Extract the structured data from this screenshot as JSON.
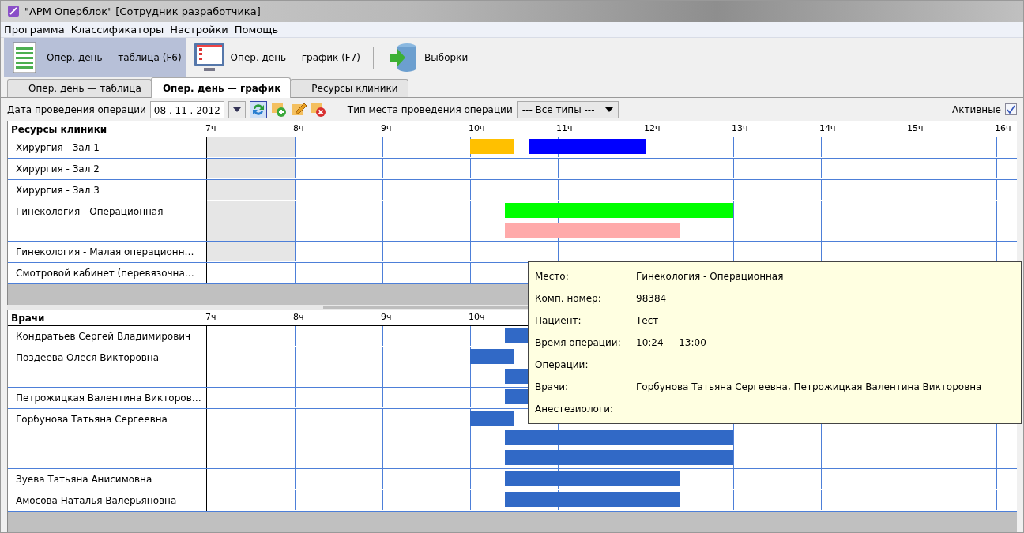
{
  "window": {
    "title": "\"АРМ Оперблок\" [Сотрудник разработчика]"
  },
  "menu": [
    "Программа",
    "Классификаторы",
    "Настройки",
    "Помощь"
  ],
  "toolbar": [
    {
      "label": "Опер. день — таблица (F6)",
      "kind": "table",
      "selected": true
    },
    {
      "label": "Опер. день — график (F7)",
      "kind": "monitor",
      "selected": false
    },
    {
      "label": "Выборки",
      "kind": "database",
      "selected": false
    }
  ],
  "tabs": [
    {
      "label": "Опер. день — таблица",
      "selected": false
    },
    {
      "label": "Опер. день — график",
      "selected": true
    },
    {
      "label": "Ресурсы клиники",
      "selected": false
    }
  ],
  "filters": {
    "date_label": "Дата проведения операции",
    "date_value": "08 . 11 . 2012",
    "type_label": "Тип места проведения операции",
    "type_value": "--- Все типы ---",
    "active_label": "Активные",
    "active_checked": true
  },
  "resources_chart": {
    "title": "Ресурсы клиники",
    "hours": [
      "7ч",
      "8ч",
      "9ч",
      "10ч",
      "11ч",
      "12ч",
      "13ч",
      "14ч",
      "15ч",
      "16ч"
    ],
    "rows": [
      {
        "name": "Хирургия - Зал 1",
        "blocked": true,
        "lanes": [
          [
            {
              "kind": "operation",
              "color": "#ffc000"
            },
            {
              "kind": "operation",
              "color": "#0000ff"
            }
          ]
        ]
      },
      {
        "name": "Хирургия - Зал 2",
        "blocked": true
      },
      {
        "name": "Хирургия - Зал 3",
        "blocked": true
      },
      {
        "name": "Гинекология - Операционная",
        "blocked": true,
        "lanes": [
          [
            {
              "kind": "operation",
              "color": "#00ff00"
            }
          ],
          [
            {
              "kind": "operation",
              "color": "#ffaaaa"
            }
          ]
        ]
      },
      {
        "name": "Гинекология - Малая операционн…",
        "blocked": true
      },
      {
        "name": "Смотровой кабинет (перевязочна…",
        "blocked": false
      }
    ]
  },
  "doctors_chart": {
    "title": "Врачи",
    "hours": [
      "7ч",
      "8ч",
      "9ч",
      "10ч"
    ],
    "rows": [
      {
        "name": "Кондратьев Сергей Владимирович",
        "lanes": [
          [
            {
              "kind": "operation"
            }
          ]
        ]
      },
      {
        "name": "Поздеева Олеся Викторовна",
        "lanes": [
          [
            {
              "kind": "operation"
            }
          ],
          [
            {
              "kind": "operation"
            }
          ]
        ]
      },
      {
        "name": "Петрожицкая Валентина Викторов…",
        "lanes": [
          [
            {
              "kind": "operation"
            }
          ]
        ]
      },
      {
        "name": "Горбунова Татьяна Сергеевна",
        "lanes": [
          [
            {
              "kind": "operation"
            }
          ],
          [
            {
              "kind": "operation"
            }
          ],
          [
            {
              "kind": "operation"
            }
          ]
        ]
      },
      {
        "name": "Зуева Татьяна Анисимовна",
        "lanes": [
          [
            {
              "kind": "operation"
            }
          ]
        ]
      },
      {
        "name": "Амосова Наталья Валерьяновна",
        "lanes": [
          [
            {
              "kind": "operation"
            }
          ]
        ]
      }
    ]
  },
  "tooltip": {
    "rows": [
      {
        "label": "Место:",
        "value": "Гинекология - Операционная"
      },
      {
        "label": "Комп. номер:",
        "value": "98384"
      },
      {
        "label": "Пациент:",
        "value": "Тест"
      },
      {
        "label": "Время операции:",
        "value": "10:24 — 13:00"
      },
      {
        "label": "Операции:"
      },
      {
        "label": "Врачи:",
        "value": "Горбунова Татьяна Сергеевна, Петрожицкая Валентина Викторовна"
      },
      {
        "label": "Анестезиологи:"
      }
    ]
  }
}
